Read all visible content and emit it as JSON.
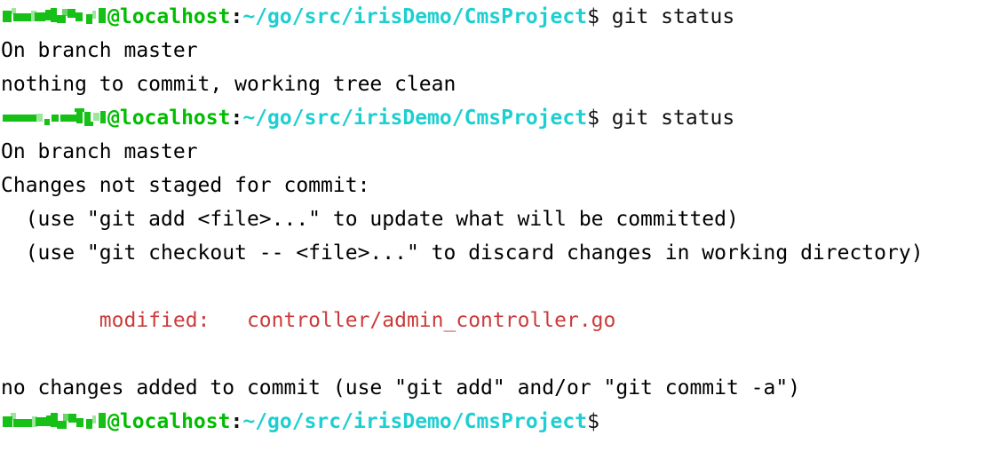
{
  "terminal": {
    "type": "shell-session",
    "background_color": "#ffffff",
    "colors": {
      "user_host": "#00bd00",
      "path": "#1ecfd1",
      "default_text": "#111111",
      "modified_file": "#cc3b3b"
    },
    "prompt": {
      "username": "",
      "username_redacted": true,
      "host": "@localhost",
      "separator": ":",
      "path": "~/go/src/irisDemo/CmsProject",
      "symbol": "$"
    },
    "lines": [
      {
        "id": "prompt-1",
        "kind": "prompt",
        "command": " git status",
        "redaction_style": "a"
      },
      {
        "id": "out-1",
        "kind": "output",
        "text": "On branch master"
      },
      {
        "id": "out-2",
        "kind": "output",
        "text": "nothing to commit, working tree clean"
      },
      {
        "id": "prompt-2",
        "kind": "prompt",
        "command": " git status",
        "redaction_style": "b"
      },
      {
        "id": "out-3",
        "kind": "output",
        "text": "On branch master"
      },
      {
        "id": "out-4",
        "kind": "output",
        "text": "Changes not staged for commit:"
      },
      {
        "id": "out-5",
        "kind": "output",
        "text": "  (use \"git add <file>...\" to update what will be committed)"
      },
      {
        "id": "out-6",
        "kind": "output",
        "text": "  (use \"git checkout -- <file>...\" to discard changes in working directory)"
      },
      {
        "id": "blank-1",
        "kind": "blank",
        "text": ""
      },
      {
        "id": "out-7",
        "kind": "output-red",
        "text": "        modified:   controller/admin_controller.go"
      },
      {
        "id": "blank-2",
        "kind": "blank",
        "text": ""
      },
      {
        "id": "out-8",
        "kind": "output",
        "text": "no changes added to commit (use \"git add\" and/or \"git commit -a\")"
      },
      {
        "id": "prompt-3",
        "kind": "prompt",
        "command": "",
        "redaction_style": "a"
      }
    ]
  }
}
